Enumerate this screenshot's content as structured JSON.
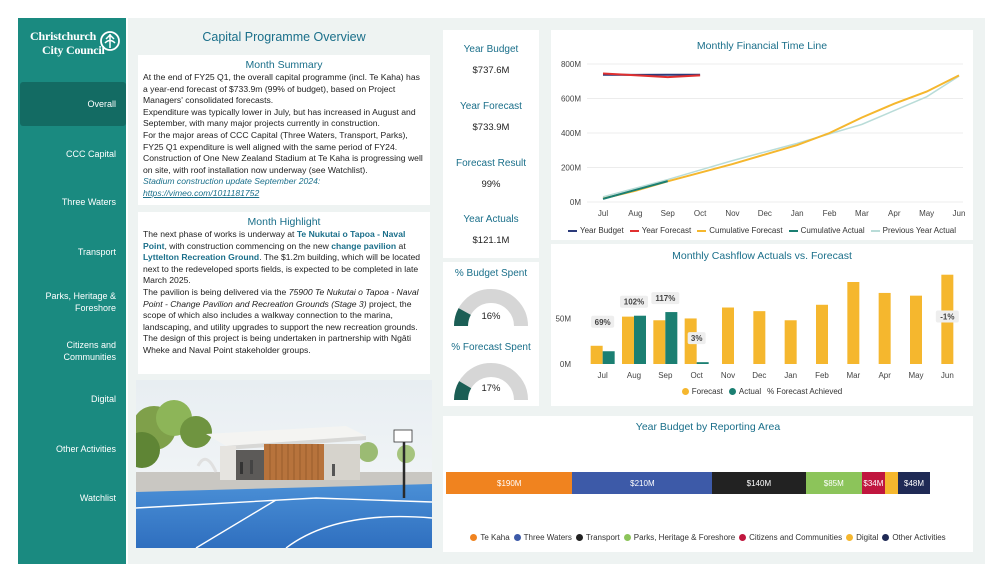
{
  "sidebar": {
    "logo_line1": "Christchurch",
    "logo_line2": "City Council",
    "items": [
      {
        "label": "Overall",
        "active": true
      },
      {
        "label": "CCC Capital"
      },
      {
        "label": "Three Waters"
      },
      {
        "label": "Transport"
      },
      {
        "label": "Parks, Heritage & Foreshore"
      },
      {
        "label": "Citizens and Communities"
      },
      {
        "label": "Digital"
      },
      {
        "label": "Other Activities"
      },
      {
        "label": "Watchlist"
      }
    ]
  },
  "header": {
    "title": "Capital Programme Overview"
  },
  "summary": {
    "title": "Month Summary",
    "p1": "At the end of FY25 Q1, the overall capital programme (incl. Te Kaha) has a year-end forecast of $733.9m (99% of budget), based on Project Managers' consolidated forecasts.",
    "p2": "Expenditure was typically lower in July, but has increased in August and September, with many major projects currently in construction.",
    "p3": "For the major areas of CCC Capital (Three Waters, Transport, Parks), FY25 Q1 expenditure is well aligned with the same period of FY24.",
    "p4": "Construction of One New Zealand Stadium at Te Kaha is progressing well on site, with roof installation now underway (see Watchlist).",
    "link_label": "Stadium construction update September 2024:",
    "link_url": "https://vimeo.com/1011181752"
  },
  "highlight": {
    "title": "Month Highlight",
    "t1": "The next phase of works is underway at ",
    "h1": "Te Nukutai o Tapoa - Naval Point",
    "t2": ", with construction commencing on the new ",
    "h2": "change pavilion",
    "t3": " at ",
    "h3": "Lyttelton Recreation Ground",
    "t4": ". The $1.2m building, which will be located next to the redeveloped sports fields, is expected to be completed in late March 2025.",
    "t5": "The pavilion is being delivered via the ",
    "i1": "75900 Te Nukutai o Tapoa - Naval Point - Change Pavilion and Recreation Grounds (Stage 3)",
    "t6": " project, the scope of which also includes a walkway connection to the marina, landscaping, and utility upgrades to support the new recreation grounds. The design of this project is being undertaken in partnership with Ngāti Wheke and Naval Point stakeholder groups."
  },
  "kpis": {
    "year_budget_label": "Year Budget",
    "year_budget_value": "$737.6M",
    "year_forecast_label": "Year Forecast",
    "year_forecast_value": "$733.9M",
    "forecast_result_label": "Forecast Result",
    "forecast_result_value": "99%",
    "year_actuals_label": "Year Actuals",
    "year_actuals_value": "$121.1M",
    "budget_spent_label": "% Budget Spent",
    "budget_spent_value": "16%",
    "budget_spent_fraction": 0.16,
    "forecast_spent_label": "% Forecast Spent",
    "forecast_spent_value": "17%",
    "forecast_spent_fraction": 0.17
  },
  "colors": {
    "teal": "#1a8a80",
    "dark_teal": "#136b63",
    "title_blue": "#1a6f8a",
    "forecast_yellow": "#f5b72e",
    "actual_teal": "#1b7f72",
    "year_budget_navy": "#2b3a7a",
    "year_forecast_red": "#e03030",
    "prev_year_light": "#b9dcd8",
    "gauge_grey": "#d6d6d6"
  },
  "chart_data": [
    {
      "type": "line",
      "title": "Monthly Financial Time Line",
      "x": [
        "Jul",
        "Aug",
        "Sep",
        "Oct",
        "Nov",
        "Dec",
        "Jan",
        "Feb",
        "Mar",
        "Apr",
        "May",
        "Jun"
      ],
      "y_ticks": [
        "0M",
        "200M",
        "400M",
        "600M",
        "800M"
      ],
      "ylim": [
        0,
        800
      ],
      "series": [
        {
          "name": "Year Budget",
          "color": "#2b3a7a",
          "values": [
            738,
            737,
            738,
            738,
            null,
            null,
            null,
            null,
            null,
            null,
            null,
            null
          ]
        },
        {
          "name": "Year Forecast",
          "color": "#e03030",
          "values": [
            745,
            735,
            724,
            734,
            null,
            null,
            null,
            null,
            null,
            null,
            null,
            null
          ]
        },
        {
          "name": "Cumulative Forecast",
          "color": "#f5b72e",
          "values": [
            20,
            65,
            120,
            170,
            220,
            275,
            330,
            400,
            490,
            570,
            640,
            734
          ]
        },
        {
          "name": "Cumulative Actual",
          "color": "#1b7f72",
          "values": [
            18,
            70,
            121,
            null,
            null,
            null,
            null,
            null,
            null,
            null,
            null,
            null
          ]
        },
        {
          "name": "Previous Year Actual",
          "color": "#b9dcd8",
          "values": [
            30,
            80,
            130,
            185,
            240,
            290,
            340,
            395,
            450,
            530,
            610,
            730
          ]
        }
      ]
    },
    {
      "type": "bar",
      "title": "Monthly Cashflow Actuals vs. Forecast",
      "categories": [
        "Jul",
        "Aug",
        "Sep",
        "Oct",
        "Nov",
        "Dec",
        "Jan",
        "Feb",
        "Mar",
        "Apr",
        "May",
        "Jun"
      ],
      "y_ticks": [
        "0M",
        "50M"
      ],
      "ylim": [
        0,
        90
      ],
      "series": [
        {
          "name": "Forecast",
          "color": "#f5b72e",
          "values": [
            20,
            52,
            48,
            50,
            62,
            58,
            48,
            65,
            90,
            78,
            75,
            98
          ]
        },
        {
          "name": "Actual",
          "color": "#1b7f72",
          "values": [
            14,
            53,
            57,
            2,
            null,
            null,
            null,
            null,
            null,
            null,
            null,
            null
          ]
        },
        {
          "name": "% Forecast Achieved",
          "values": [
            "69%",
            "102%",
            "117%",
            "3%",
            null,
            null,
            null,
            null,
            null,
            null,
            null,
            "-1%"
          ]
        }
      ]
    },
    {
      "type": "bar",
      "title": "Year Budget by Reporting Area",
      "stacked": true,
      "series": [
        {
          "name": "Te Kaha",
          "value": 190,
          "label": "$190M",
          "color": "#f0831f"
        },
        {
          "name": "Three Waters",
          "value": 210,
          "label": "$210M",
          "color": "#3d5aa8"
        },
        {
          "name": "Transport",
          "value": 140,
          "label": "$140M",
          "color": "#222222"
        },
        {
          "name": "Parks, Heritage & Foreshore",
          "value": 85,
          "label": "$85M",
          "color": "#8cc45a"
        },
        {
          "name": "Citizens and Communities",
          "value": 34,
          "label": "$34M",
          "color": "#c0163e"
        },
        {
          "name": "Digital",
          "value": 20,
          "label": "",
          "color": "#f5b72e"
        },
        {
          "name": "Other Activities",
          "value": 48,
          "label": "$48M",
          "color": "#1f2a55"
        }
      ]
    }
  ]
}
